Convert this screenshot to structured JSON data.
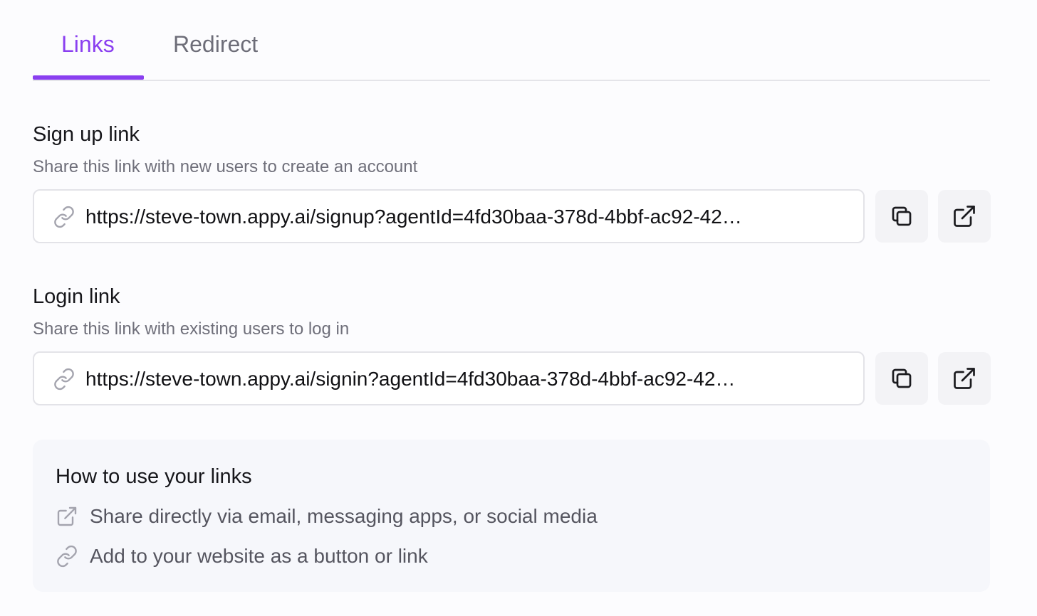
{
  "tabs": [
    {
      "label": "Links",
      "active": true
    },
    {
      "label": "Redirect",
      "active": false
    }
  ],
  "signup": {
    "title": "Sign up link",
    "description": "Share this link with new users to create an account",
    "url": "https://steve-town.appy.ai/signup?agentId=4fd30baa-378d-4bbf-ac92-42…"
  },
  "login": {
    "title": "Login link",
    "description": "Share this link with existing users to log in",
    "url": "https://steve-town.appy.ai/signin?agentId=4fd30baa-378d-4bbf-ac92-42…"
  },
  "info": {
    "title": "How to use your links",
    "items": [
      {
        "icon": "external-link-icon",
        "text": "Share directly via email, messaging apps, or social media"
      },
      {
        "icon": "link-icon",
        "text": "Add to your website as a button or link"
      }
    ]
  },
  "colors": {
    "accent": "#8a3ff0",
    "border": "#e3e3e8",
    "muted_text": "#6f6f7a",
    "button_bg": "#f3f3f6",
    "info_bg": "#f6f7fb"
  }
}
